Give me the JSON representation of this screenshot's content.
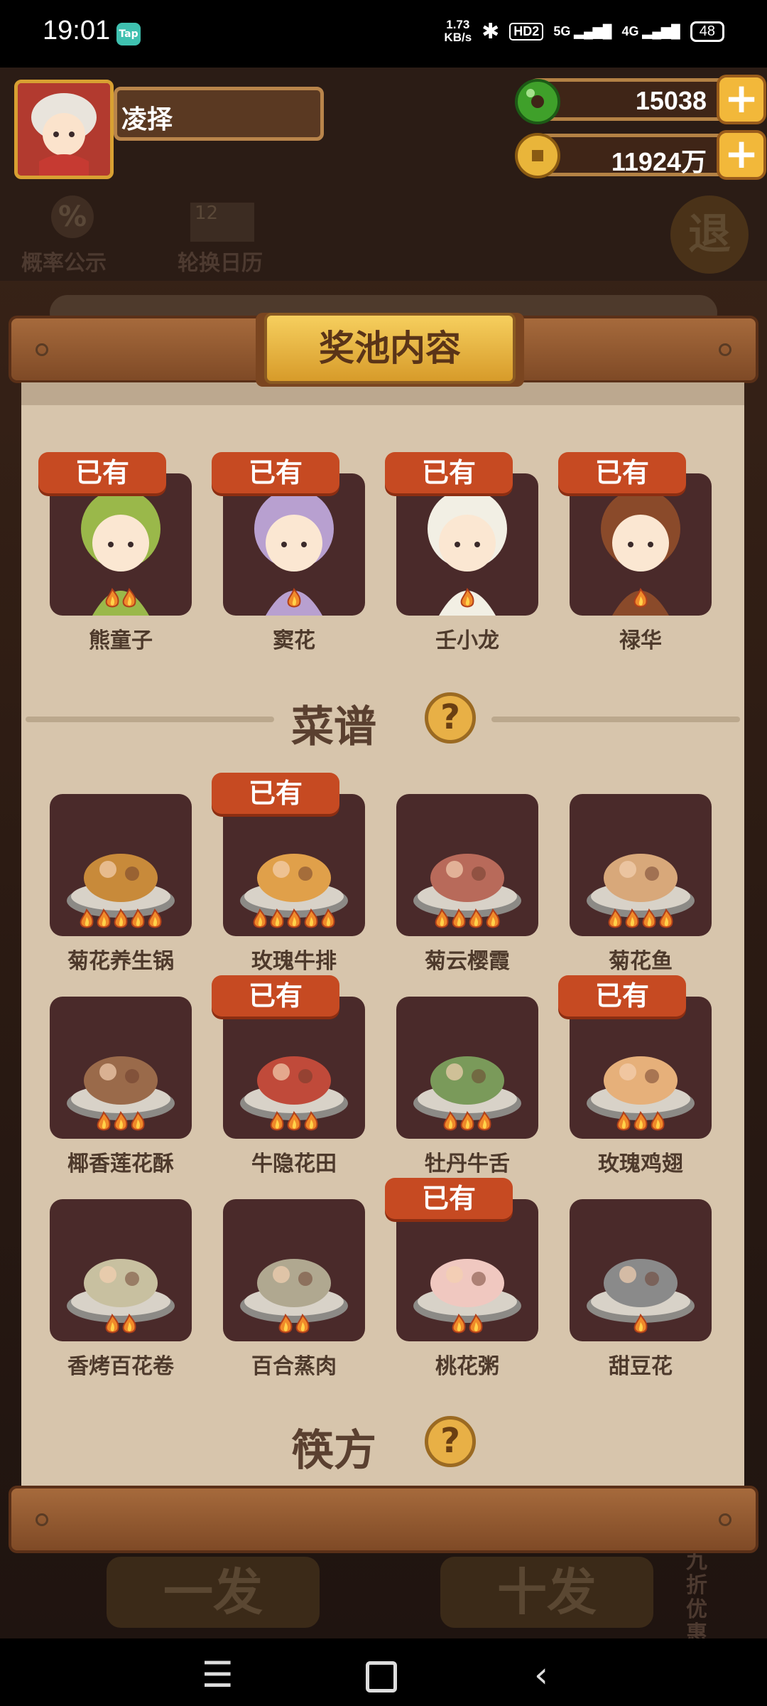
{
  "status_bar": {
    "time": "19:01",
    "tap_label": "Tap",
    "net_speed_value": "1.73",
    "net_speed_unit": "KB/s",
    "hd_label": "HD2",
    "signal_5g": "5G",
    "signal_4g": "4G",
    "battery": "48"
  },
  "player": {
    "name": "凌择"
  },
  "currencies": [
    {
      "name": "jade",
      "value": "15038"
    },
    {
      "name": "coin",
      "value": "11924万"
    }
  ],
  "background": {
    "tab_probability": "概率公示",
    "tab_calendar": "轮换日历",
    "calendar_day": "12",
    "exit_label": "退",
    "bottom_left_btn": "一发",
    "bottom_right_btn": "十发",
    "side_promo": "九折优惠"
  },
  "modal": {
    "title": "奖池内容",
    "owned_label": "已有",
    "characters": [
      {
        "name": "熊童子",
        "owned": true,
        "flames": 2
      },
      {
        "name": "窦花",
        "owned": true,
        "flames": 1
      },
      {
        "name": "壬小龙",
        "owned": true,
        "flames": 1
      },
      {
        "name": "禄华",
        "owned": true,
        "flames": 1
      }
    ],
    "recipe_section": {
      "title": "菜谱",
      "help": "?"
    },
    "recipes": [
      {
        "name": "菊花养生锅",
        "owned": false,
        "flames": 5
      },
      {
        "name": "玫瑰牛排",
        "owned": true,
        "flames": 5
      },
      {
        "name": "菊云樱霞",
        "owned": false,
        "flames": 4
      },
      {
        "name": "菊花鱼",
        "owned": false,
        "flames": 4
      },
      {
        "name": "椰香莲花酥",
        "owned": false,
        "flames": 3
      },
      {
        "name": "牛隐花田",
        "owned": true,
        "flames": 3
      },
      {
        "name": "牡丹牛舌",
        "owned": false,
        "flames": 3
      },
      {
        "name": "玫瑰鸡翅",
        "owned": true,
        "flames": 3
      },
      {
        "name": "香烤百花卷",
        "owned": false,
        "flames": 2
      },
      {
        "name": "百合蒸肉",
        "owned": false,
        "flames": 2
      },
      {
        "name": "桃花粥",
        "owned": true,
        "flames": 2
      },
      {
        "name": "甜豆花",
        "owned": false,
        "flames": 1
      }
    ],
    "next_section": {
      "title": "筷方",
      "help": "?"
    }
  },
  "nav": {
    "menu_icon": "menu-icon",
    "home_icon": "home-icon",
    "back_icon": "back-icon"
  },
  "colors": {
    "owned_badge": "#c64a22",
    "card_bg": "#4a2a2a",
    "panel_bg": "#d7c5ac",
    "title_plaque": "#e6b440"
  }
}
